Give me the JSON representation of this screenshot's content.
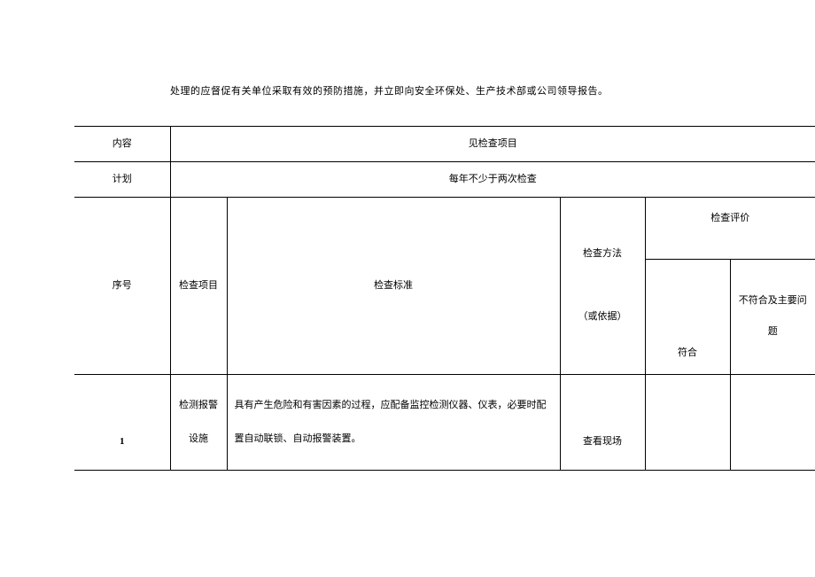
{
  "intro": "处理的应督促有关单位采取有效的预防措施，并立即向安全环保处、生产技术部或公司领导报告。",
  "rows": {
    "content_label": "内容",
    "content_value": "见检查项目",
    "plan_label": "计划",
    "plan_value": "每年不少于两次检查"
  },
  "headers": {
    "seq": "序号",
    "item": "检查项目",
    "standard": "检查标准",
    "method": "检查方法",
    "method_sub": "（或依据）",
    "eval": "检查评价",
    "eval_conform": "符合",
    "eval_issue": "不符合及主要问题"
  },
  "body": {
    "r1": {
      "seq": "1",
      "item_line1": "检测报警",
      "item_line2": "设施",
      "standard": "具有产生危险和有害因素的过程，应配备监控检测仪器、仪表，必要时配置自动联锁、自动报警装置。",
      "method": "查看现场"
    }
  }
}
